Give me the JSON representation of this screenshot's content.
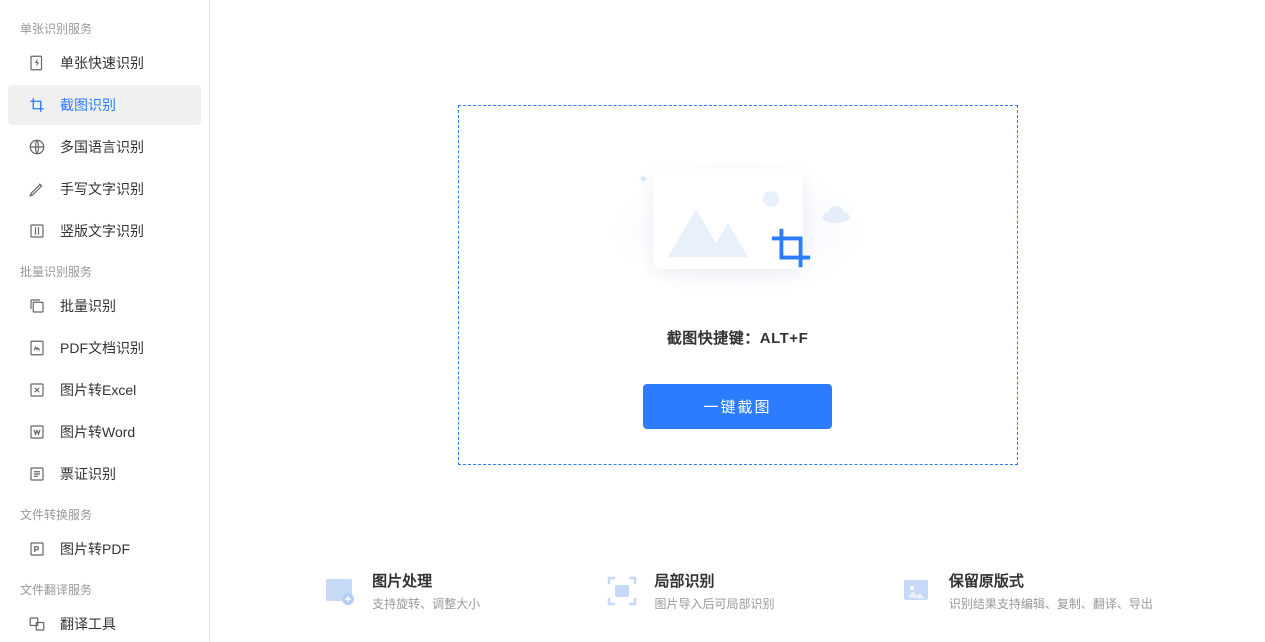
{
  "sidebar": {
    "sections": [
      {
        "header": "单张识别服务",
        "items": [
          {
            "label": "单张快速识别",
            "icon": "bolt-doc-icon",
            "active": false
          },
          {
            "label": "截图识别",
            "icon": "crop-icon",
            "active": true
          },
          {
            "label": "多国语言识别",
            "icon": "globe-icon",
            "active": false
          },
          {
            "label": "手写文字识别",
            "icon": "pen-icon",
            "active": false
          },
          {
            "label": "竖版文字识别",
            "icon": "vertical-text-icon",
            "active": false
          }
        ]
      },
      {
        "header": "批量识别服务",
        "items": [
          {
            "label": "批量识别",
            "icon": "stack-icon",
            "active": false
          },
          {
            "label": "PDF文档识别",
            "icon": "pdf-icon",
            "active": false
          },
          {
            "label": "图片转Excel",
            "icon": "excel-icon",
            "active": false
          },
          {
            "label": "图片转Word",
            "icon": "word-icon",
            "active": false
          },
          {
            "label": "票证识别",
            "icon": "receipt-icon",
            "active": false
          }
        ]
      },
      {
        "header": "文件转换服务",
        "items": [
          {
            "label": "图片转PDF",
            "icon": "pdf-convert-icon",
            "active": false
          }
        ]
      },
      {
        "header": "文件翻译服务",
        "items": [
          {
            "label": "翻译工具",
            "icon": "translate-icon",
            "active": false
          }
        ]
      }
    ]
  },
  "main": {
    "shortcut_label": "截图快捷键：ALT+F",
    "capture_button": "一键截图"
  },
  "features": [
    {
      "title": "图片处理",
      "desc": "支持旋转、调整大小"
    },
    {
      "title": "局部识别",
      "desc": "图片导入后可局部识别"
    },
    {
      "title": "保留原版式",
      "desc": "识别结果支持编辑、复制、翻译、导出"
    }
  ]
}
